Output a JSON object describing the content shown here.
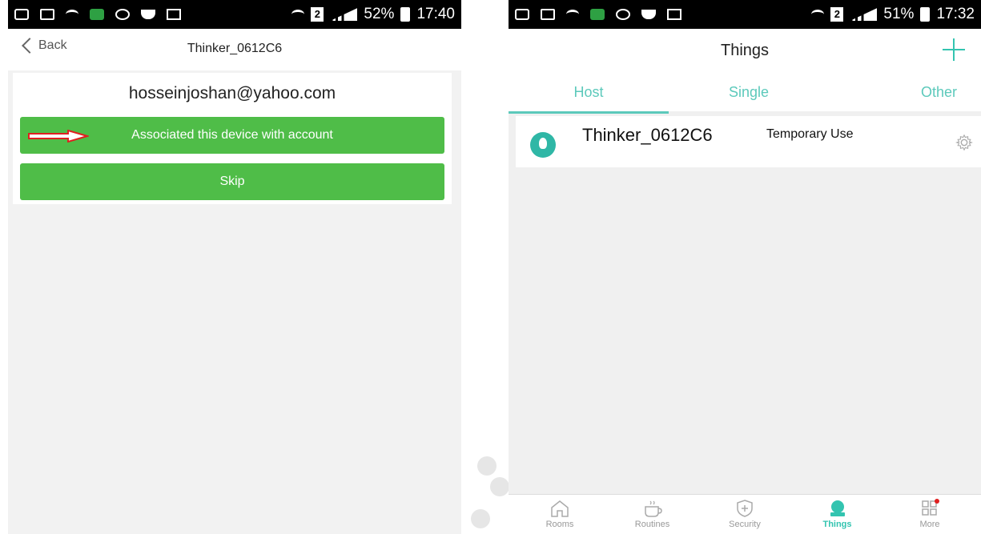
{
  "left": {
    "status": {
      "battery": "52%",
      "time": "17:40",
      "sim": "2"
    },
    "nav": {
      "back_label": "Back",
      "title": "Thinker_0612C6"
    },
    "email": "hosseinjoshan@yahoo.com",
    "associate_label": "Associated this device with account",
    "skip_label": "Skip"
  },
  "right": {
    "status": {
      "battery": "51%",
      "time": "17:32",
      "sim": "2"
    },
    "title": "Things",
    "tabs": [
      {
        "label": "Host"
      },
      {
        "label": "Single"
      },
      {
        "label": "Other"
      }
    ],
    "device": {
      "name": "Thinker_0612C6",
      "tag": "Temporary Use"
    },
    "bottom_nav": [
      {
        "label": "Rooms"
      },
      {
        "label": "Routines"
      },
      {
        "label": "Security"
      },
      {
        "label": "Things"
      },
      {
        "label": "More"
      }
    ]
  },
  "colors": {
    "accent_green": "#4fbd48",
    "accent_teal": "#33c4b0",
    "arrow_red": "#e02020"
  }
}
